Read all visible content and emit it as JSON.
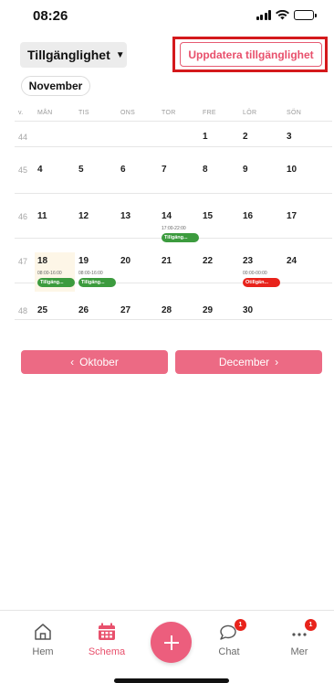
{
  "status_bar": {
    "time": "08:26"
  },
  "toolbar": {
    "mode_select": "Tillgänglighet",
    "update_button": "Uppdatera tillgänglighet"
  },
  "month_label": "November",
  "calendar": {
    "headers": [
      "v.",
      "MÅN",
      "TIS",
      "ONS",
      "TOR",
      "FRE",
      "LÖR",
      "SÖN"
    ],
    "weeks": [
      {
        "week": "44",
        "days": [
          "",
          "",
          "",
          "",
          "1",
          "2",
          "3"
        ]
      },
      {
        "week": "45",
        "days": [
          "4",
          "5",
          "6",
          "7",
          "8",
          "9",
          "10"
        ]
      },
      {
        "week": "46",
        "days": [
          "11",
          "12",
          "13",
          "14",
          "15",
          "16",
          "17"
        ]
      },
      {
        "week": "47",
        "days": [
          "18",
          "19",
          "20",
          "21",
          "22",
          "23",
          "24"
        ]
      },
      {
        "week": "48",
        "days": [
          "25",
          "26",
          "27",
          "28",
          "29",
          "30",
          ""
        ]
      }
    ],
    "events": [
      {
        "week_index": 2,
        "day_index": 3,
        "time": "17:00-22:00",
        "label": "Tillgäng...",
        "status": "green"
      },
      {
        "week_index": 3,
        "day_index": 0,
        "time": "08:00-16:00",
        "label": "Tillgäng...",
        "status": "green"
      },
      {
        "week_index": 3,
        "day_index": 1,
        "time": "08:00-16:00",
        "label": "Tillgäng...",
        "status": "green"
      },
      {
        "week_index": 3,
        "day_index": 5,
        "time": "00:00-00:00",
        "label": "Otillgän...",
        "status": "red"
      }
    ],
    "today": {
      "week_index": 3,
      "day_index": 0
    }
  },
  "nav": {
    "prev_label": "Oktober",
    "next_label": "December",
    "prev_icon": "chevron-left-icon",
    "next_icon": "chevron-right-icon"
  },
  "tabbar": {
    "tabs": [
      {
        "label": "Hem",
        "icon": "home-icon"
      },
      {
        "label": "Schema",
        "icon": "calendar-icon"
      },
      {
        "label": "Chat",
        "icon": "chat-icon",
        "badge": "1"
      },
      {
        "label": "Mer",
        "icon": "more-icon",
        "badge": "1"
      }
    ],
    "add_icon": "plus-icon"
  },
  "colors": {
    "accent": "#e8506c",
    "green": "#3c9b3e",
    "red": "#e8231b",
    "highlight": "#d4191c"
  }
}
